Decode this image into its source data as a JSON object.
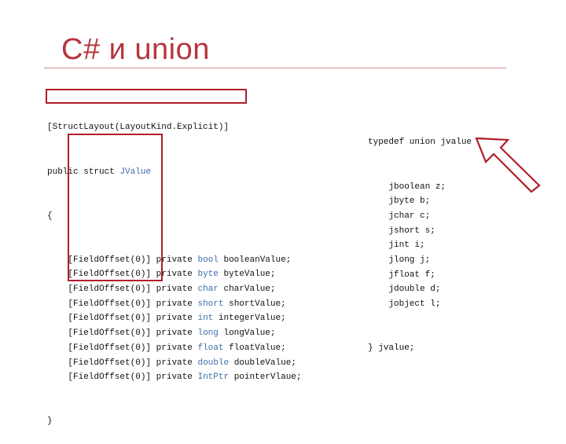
{
  "slide": {
    "title": "C# и union"
  },
  "csharp": {
    "attribute": "[StructLayout(LayoutKind.Explicit)]",
    "decl_public": "public struct",
    "decl_name": "JValue",
    "open_brace": "{",
    "close_brace": "}",
    "fields": [
      {
        "attr": "[FieldOffset(0)]",
        "access": "private",
        "type": "bool",
        "name": "booleanValue;"
      },
      {
        "attr": "[FieldOffset(0)]",
        "access": "private",
        "type": "byte",
        "name": "byteValue;"
      },
      {
        "attr": "[FieldOffset(0)]",
        "access": "private",
        "type": "char",
        "name": "charValue;"
      },
      {
        "attr": "[FieldOffset(0)]",
        "access": "private",
        "type": "short",
        "name": "shortValue;"
      },
      {
        "attr": "[FieldOffset(0)]",
        "access": "private",
        "type": "int",
        "name": "integerValue;"
      },
      {
        "attr": "[FieldOffset(0)]",
        "access": "private",
        "type": "long",
        "name": "longValue;"
      },
      {
        "attr": "[FieldOffset(0)]",
        "access": "private",
        "type": "float",
        "name": "floatValue;"
      },
      {
        "attr": "[FieldOffset(0)]",
        "access": "private",
        "type": "double",
        "name": "doubleValue;"
      },
      {
        "attr": "[FieldOffset(0)]",
        "access": "private",
        "type": "IntPtr",
        "name": "pointerVlaue;"
      }
    ]
  },
  "c_code": {
    "header": "typedef union jvalue {",
    "members": [
      "jboolean z;",
      "jbyte b;",
      "jchar c;",
      "jshort s;",
      "jint i;",
      "jlong j;",
      "jfloat f;",
      "jdouble d;",
      "jobject l;"
    ],
    "footer": "} jvalue;"
  },
  "colors": {
    "title": "#b5353d",
    "highlight_box": "#b01e28",
    "type_keyword": "#3d6fa8",
    "arrow_fill": "#ffffff",
    "arrow_stroke": "#b01e28"
  },
  "icons": {
    "arrow": "arrow-up-left-icon"
  }
}
